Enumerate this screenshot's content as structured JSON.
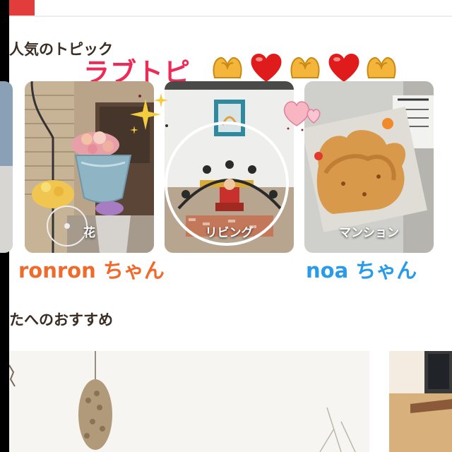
{
  "header": {
    "accent_color": "#e33c3c"
  },
  "popular": {
    "title": "人気のトピック",
    "overlay_text": "ラブトピ",
    "overlay_color": "#ee2a56",
    "cards": [
      {
        "label": ""
      },
      {
        "label": "花"
      },
      {
        "label": "リビング"
      },
      {
        "label": "マンション"
      }
    ]
  },
  "tags": [
    {
      "text": "ronron ちゃん",
      "color": "#f06a2c"
    },
    {
      "text": "noa ちゃん",
      "color": "#2a9be8"
    }
  ],
  "recommend": {
    "title": "たへのおすすめ"
  },
  "stickers": [
    "hand-heart",
    "red-heart",
    "hand-heart",
    "red-heart",
    "hand-heart",
    "sparkles",
    "pink-hearts"
  ]
}
